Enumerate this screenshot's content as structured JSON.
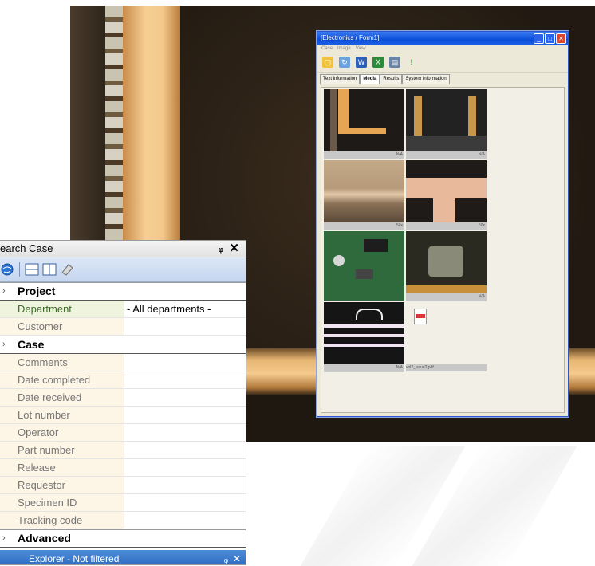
{
  "app_window": {
    "title": "[Electronics / Form1]",
    "menu": [
      "Case",
      "Image",
      "View"
    ],
    "controls": {
      "minimize": "_",
      "maximize": "□",
      "close": "✕"
    },
    "tabs": [
      {
        "label": "Text information",
        "active": false
      },
      {
        "label": "Media",
        "active": true
      },
      {
        "label": "Results",
        "active": false
      },
      {
        "label": "System information",
        "active": false
      }
    ],
    "media": [
      {
        "caption": "N/A"
      },
      {
        "caption": "N/A"
      },
      {
        "caption": "50x"
      },
      {
        "caption": "50x"
      },
      {
        "caption": ""
      },
      {
        "caption": "N/A"
      },
      {
        "caption": "N/A"
      },
      {
        "caption": "vol2_issue2.pdf"
      }
    ],
    "toolbar_icons": [
      "folder-icon",
      "refresh-icon",
      "word-icon",
      "excel-icon",
      "presentation-icon",
      "exclamation-icon"
    ]
  },
  "search_panel": {
    "title": "earch Case",
    "pin": "ᵩ",
    "close": "✕",
    "toolbar_icons": [
      "globe-icon",
      "horizontal-split-icon",
      "vertical-split-icon",
      "eraser-icon"
    ],
    "groups": [
      {
        "label": "Project",
        "rows": [
          {
            "label": "Department",
            "value": "- All departments -"
          },
          {
            "label": "Customer",
            "value": ""
          }
        ]
      },
      {
        "label": "Case",
        "rows": [
          {
            "label": "Comments",
            "value": ""
          },
          {
            "label": "Date completed",
            "value": ""
          },
          {
            "label": "Date received",
            "value": ""
          },
          {
            "label": "Lot number",
            "value": ""
          },
          {
            "label": "Operator",
            "value": ""
          },
          {
            "label": "Part number",
            "value": ""
          },
          {
            "label": "Release",
            "value": ""
          },
          {
            "label": "Requestor",
            "value": ""
          },
          {
            "label": "Specimen ID",
            "value": ""
          },
          {
            "label": "Tracking code",
            "value": ""
          }
        ]
      },
      {
        "label": "Advanced",
        "rows": []
      }
    ],
    "footer_text": "Explorer - Not filtered"
  },
  "colors": {
    "title_blue": "#0a4ed8",
    "label_bg": "#fdf5e6",
    "highlight_label": "#3f6b2a"
  }
}
